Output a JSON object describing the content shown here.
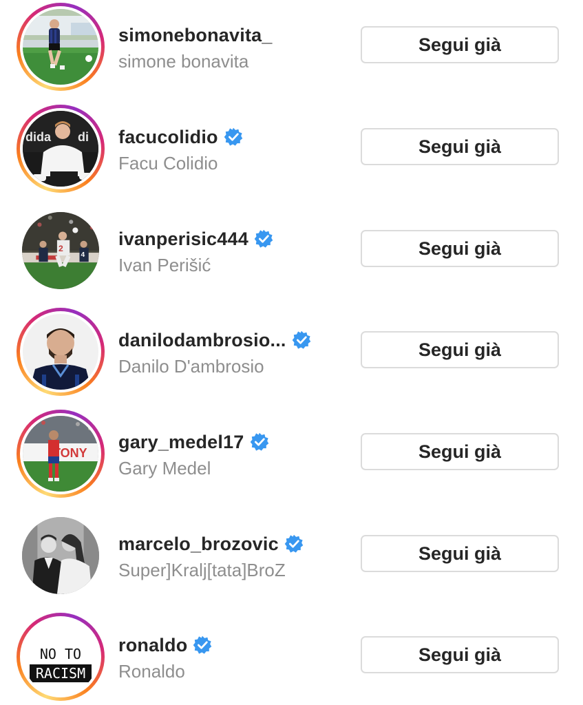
{
  "accounts": [
    {
      "username": "simonebonavita_",
      "full_name": "simone bonavita",
      "verified": false,
      "button_label": "Segui già"
    },
    {
      "username": "facucolidio",
      "full_name": "Facu Colidio",
      "verified": true,
      "button_label": "Segui già"
    },
    {
      "username": "ivanperisic444",
      "full_name": "Ivan Perišić",
      "verified": true,
      "button_label": "Segui già"
    },
    {
      "username": "danilodambrosio...",
      "full_name": "Danilo D'ambrosio",
      "verified": true,
      "button_label": "Segui già"
    },
    {
      "username": "gary_medel17",
      "full_name": "Gary Medel",
      "verified": true,
      "button_label": "Segui già"
    },
    {
      "username": "marcelo_brozovic",
      "full_name": "Super]Kralj[tata]BroZ",
      "verified": true,
      "button_label": "Segui già"
    },
    {
      "username": "ronaldo",
      "full_name": "Ronaldo",
      "verified": true,
      "button_label": "Segui già"
    }
  ],
  "avatar_texts": {
    "ronaldo_line1": "NO TO",
    "ronaldo_line2": "RACISM",
    "gary_banner": "TONY"
  },
  "icons": {
    "verified": "verified-badge-icon"
  },
  "colors": {
    "verified_blue": "#3897f0",
    "username_text": "#262626",
    "fullname_text": "#8e8e8e",
    "button_border": "#dbdbdb"
  }
}
